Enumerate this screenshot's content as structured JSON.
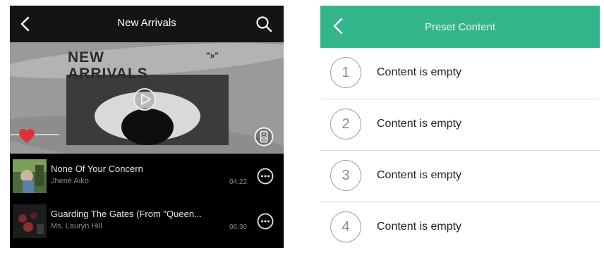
{
  "left": {
    "title": "New Arrivals",
    "banner": {
      "headline": "NEW\nARRIVALS",
      "badge": "\"»\""
    },
    "tracks": [
      {
        "title": "None Of Your Concern",
        "artist": "Jhené Aiko",
        "duration": "04:22"
      },
      {
        "title": "Guarding The Gates (From \"Queen...",
        "artist": "Ms. Lauryn Hill",
        "duration": "06:30"
      }
    ]
  },
  "right": {
    "title": "Preset Content",
    "presets": [
      {
        "number": "1",
        "label": "Content is empty"
      },
      {
        "number": "2",
        "label": "Content is empty"
      },
      {
        "number": "3",
        "label": "Content is empty"
      },
      {
        "number": "4",
        "label": "Content is empty"
      }
    ]
  },
  "colors": {
    "accent": "#33b58c",
    "heart": "#e0303b"
  },
  "icons": [
    "back-icon",
    "search-icon",
    "play-icon",
    "heart-icon",
    "speaker-icon",
    "more-icon"
  ]
}
